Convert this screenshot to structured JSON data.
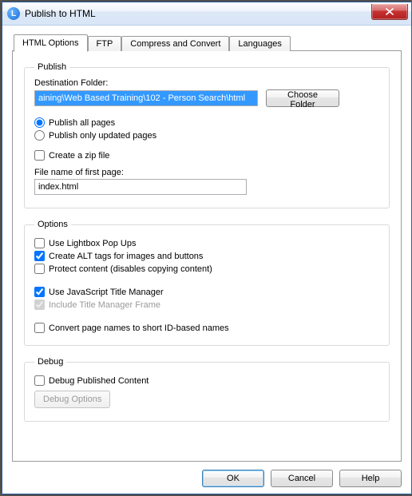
{
  "window": {
    "title": "Publish to HTML"
  },
  "tabs": {
    "html_options": "HTML Options",
    "ftp": "FTP",
    "compress": "Compress and Convert",
    "languages": "Languages"
  },
  "publish": {
    "legend": "Publish",
    "destination_label": "Destination Folder:",
    "destination_value": "aining\\Web Based Training\\102 - Person Search\\html",
    "choose_folder": "Choose Folder",
    "publish_all": "Publish all pages",
    "publish_updated": "Publish only updated pages",
    "create_zip": "Create a zip file",
    "first_page_label": "File name of first page:",
    "first_page_value": "index.html"
  },
  "options": {
    "legend": "Options",
    "lightbox": "Use Lightbox Pop Ups",
    "alt_tags": "Create ALT tags for images and buttons",
    "protect": "Protect content (disables copying content)",
    "js_title_manager": "Use JavaScript Title Manager",
    "include_title_frame": "Include Title Manager Frame",
    "convert_names": "Convert page names to short ID-based names"
  },
  "debug": {
    "legend": "Debug",
    "debug_published": "Debug Published Content",
    "debug_options": "Debug Options"
  },
  "footer": {
    "ok": "OK",
    "cancel": "Cancel",
    "help": "Help"
  }
}
